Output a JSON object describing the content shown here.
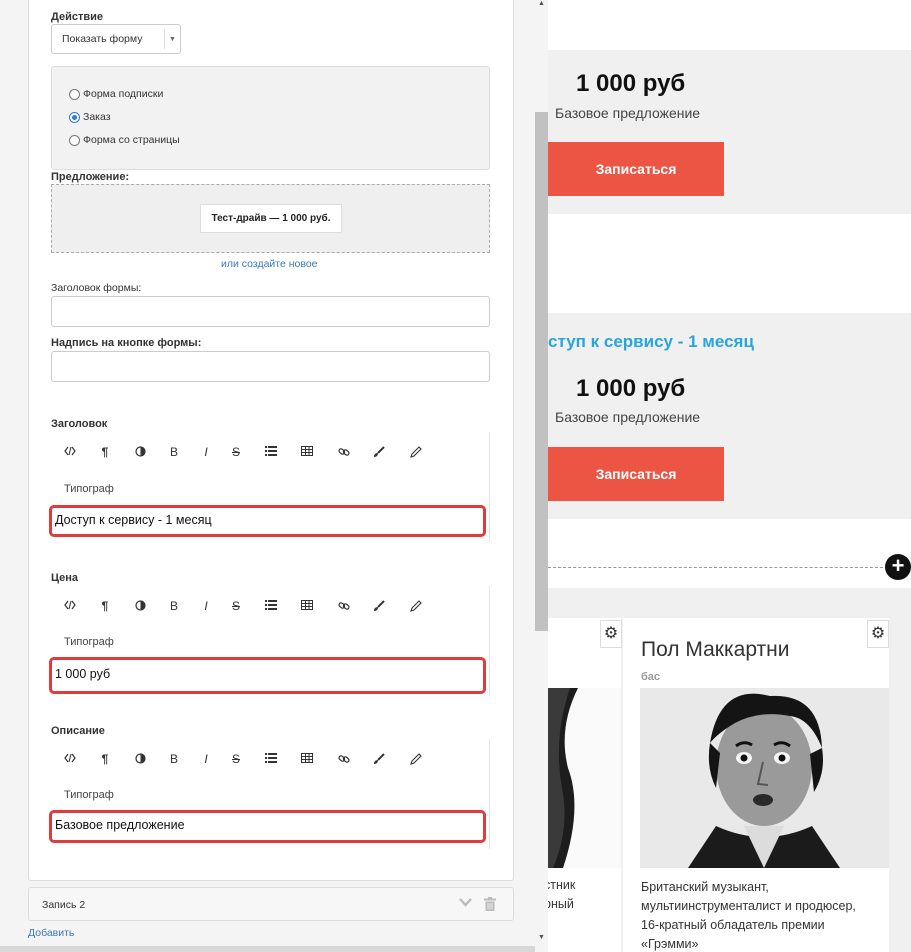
{
  "editor": {
    "action_label": "Действие",
    "action_select_value": "Показать форму",
    "radios": [
      {
        "label": "Форма подписки",
        "checked": false
      },
      {
        "label": "Заказ",
        "checked": true
      },
      {
        "label": "Форма со страницы",
        "checked": false
      }
    ],
    "offer_label": "Предложение:",
    "offer_item": "Тест-драйв — 1 000 руб.",
    "create_new_link": "или создайте новое",
    "form_title_label": "Заголовок формы:",
    "form_title_value": "",
    "form_button_label": "Надпись на кнопке формы:",
    "form_button_value": "",
    "sections": [
      {
        "label": "Заголовок",
        "tipograf": "Типограф",
        "value": "Доступ к сервису - 1 месяц"
      },
      {
        "label": "Цена",
        "tipograf": "Типограф",
        "value": "1 000 руб"
      },
      {
        "label": "Описание",
        "tipograf": "Типограф",
        "value": "Базовое предложение"
      }
    ],
    "toolbar_icons": [
      "code-icon",
      "paragraph-icon",
      "contrast-icon",
      "bold-icon",
      "italic-icon",
      "strikethrough-icon",
      "list-icon",
      "table-icon",
      "link-icon",
      "brush-icon",
      "pencil-icon"
    ],
    "toolbar_glyphs": {
      "bold": "B",
      "italic": "I",
      "strike": "S",
      "paragraph": "¶"
    },
    "record2_label": "Запись 2",
    "add_link": "Добавить"
  },
  "preview": {
    "card1": {
      "price": "1 000 руб",
      "desc": "Базовое предложение",
      "button": "Записаться"
    },
    "card2": {
      "title": "ступ к сервису - 1 месяц",
      "price": "1 000 руб",
      "desc": "Базовое предложение",
      "button": "Записаться"
    },
    "add_block_symbol": "+",
    "member_left": {
      "desc_lines": [
        "стник",
        "рный"
      ]
    },
    "member_right": {
      "name": "Пол Маккартни",
      "role": "бас",
      "desc": "Британский музыкант, мультиинструменталист и продюсер, 16-кратный обладатель премии «Грэмми»"
    },
    "colors": {
      "accent_button": "#ec5544",
      "title_blue": "#27a6d9",
      "highlight_red": "#e03c3c"
    }
  }
}
